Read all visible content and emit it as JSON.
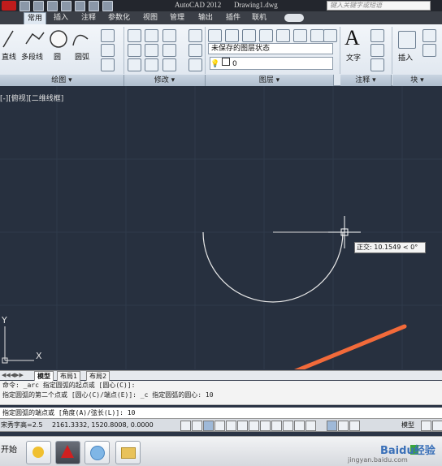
{
  "titlebar": {
    "app_title": "AutoCAD 2012",
    "file_title": "Drawing1.dwg",
    "search_placeholder": "键入关键字或短语"
  },
  "tabs": [
    "常用",
    "插入",
    "注释",
    "参数化",
    "视图",
    "管理",
    "输出",
    "插件",
    "联机"
  ],
  "ribbon": {
    "draw": {
      "panel_label": "绘图 ▾",
      "tools": [
        "直线",
        "多段线",
        "圆",
        "圆弧"
      ]
    },
    "modify": {
      "panel_label": "修改 ▾"
    },
    "layers": {
      "panel_label": "图层 ▾",
      "layer_state": "未保存的图层状态",
      "current_layer": "0"
    },
    "annotation": {
      "panel_label": "注释 ▾",
      "text_label": "文字"
    },
    "block": {
      "panel_label": "块 ▾",
      "insert_label": "插入"
    }
  },
  "viewport": {
    "label": "[-][俯视][二维线框]",
    "coord_tooltip": "正交: 10.1549 < 0°",
    "axis_x": "X",
    "axis_y": "Y"
  },
  "layout_tabs": [
    "模型",
    "布局1",
    "布局2"
  ],
  "command": {
    "history": [
      "命令: _arc 指定圆弧的起点或 [圆心(C)]:",
      "指定圆弧的第二个点或 [圆心(C)/端点(E)]: _c 指定圆弧的圆心: 10"
    ],
    "current": "指定圆弧的端点或 [角度(A)/弦长(L)]: 10"
  },
  "status": {
    "text_height": "宋秀字高=2.5",
    "coordinates": "2161.3332, 1520.8008, 0.0000",
    "model_label": "模型"
  },
  "taskbar": {
    "start_label": "开始",
    "items": [
      "outlook-icon",
      "autocad-icon",
      "paint-icon",
      "folder-icon"
    ]
  },
  "watermark": {
    "brand": "Baidu经验",
    "url": "jingyan.baidu.com"
  },
  "colors": {
    "canvas": "#27303f",
    "arrow": "#f26a3a",
    "arc": "#e8e8e8"
  }
}
